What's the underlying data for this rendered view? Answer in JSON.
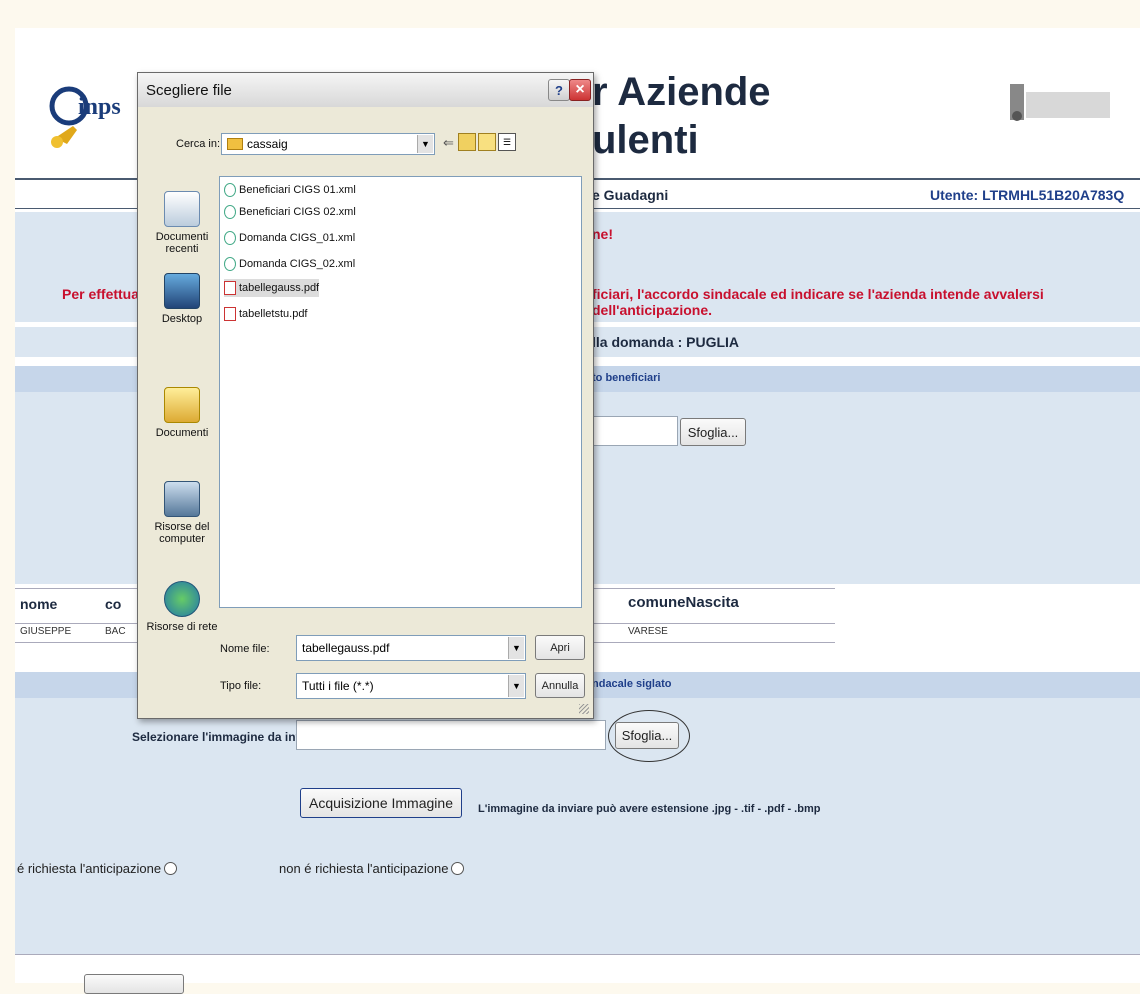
{
  "header": {
    "logo_text": "e-inps",
    "title_line1": "r Aziende",
    "title_line2": "ulenti",
    "section_title": "e Guadagni",
    "user_label": "Utente: LTRMHL51B20A783Q"
  },
  "alert": {
    "line1": "ne!",
    "line2_left": "Per effettuar",
    "line2_right": "ficiari, l'accordo sindacale ed indicare se l'azienda intende avvalersi dell'anticipazione."
  },
  "region": {
    "text": "lla domanda : PUGLIA"
  },
  "beneficiari": {
    "header": "to beneficiari",
    "browse_label": "Sfoglia..."
  },
  "table": {
    "headers": [
      "nome",
      "co",
      "comuneNascita"
    ],
    "row": [
      "GIUSEPPE",
      "BAC",
      "VARESE"
    ]
  },
  "accordo": {
    "header": "ndacale siglato",
    "select_label": "Selezionare l'immagine da inviare",
    "browse_label": "Sfoglia...",
    "acquire_label": "Acquisizione Immagine",
    "extension_note": "L'immagine da inviare può avere estensione  .jpg - .tif - .pdf - .bmp"
  },
  "anticipazione": {
    "option_yes": "é richiesta l'anticipazione",
    "option_no": "non é richiesta l'anticipazione"
  },
  "dialog": {
    "title": "Scegliere file",
    "look_in_label": "Cerca in:",
    "look_in_value": "cassaig",
    "places": [
      "Documenti recenti",
      "Desktop",
      "Documenti",
      "Risorse del computer",
      "Risorse di rete"
    ],
    "files": [
      "Beneficiari CIGS 01.xml",
      "Beneficiari CIGS 02.xml",
      "Domanda CIGS_01.xml",
      "Domanda CIGS_02.xml",
      "tabellegauss.pdf",
      "tabelletstu.pdf"
    ],
    "filename_label": "Nome file:",
    "filename_value": "tabellegauss.pdf",
    "filetype_label": "Tipo file:",
    "filetype_value": "Tutti i file (*.*)",
    "open_label": "Apri",
    "cancel_label": "Annulla",
    "help_label": "?",
    "close_label": "×"
  },
  "colors": {
    "alert_red": "#c8102e",
    "band_blue": "#dbe6f1",
    "header_dark": "#c6d6ea"
  }
}
